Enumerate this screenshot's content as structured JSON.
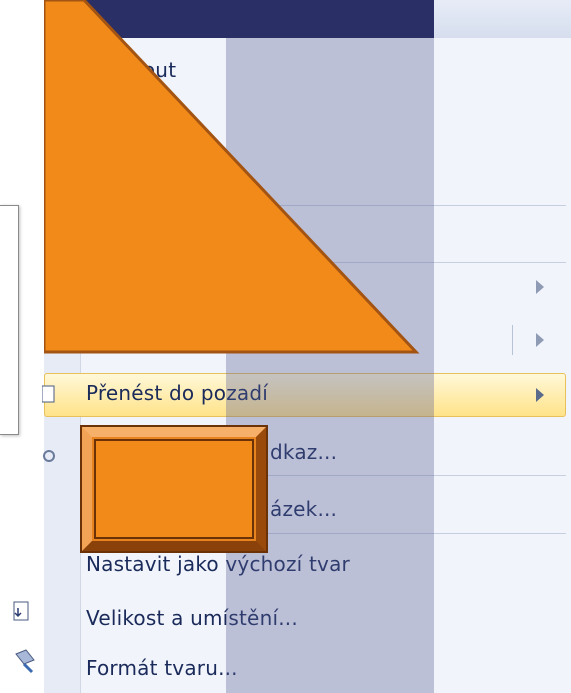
{
  "menu": {
    "items": [
      {
        "id": "bring-forward-partial",
        "label": "nout"
      },
      {
        "id": "partial-2",
        "label": "t"
      },
      {
        "id": "send-to-back",
        "label": "Přenést do pozadí"
      },
      {
        "id": "hyperlink",
        "label": "dkaz..."
      },
      {
        "id": "save-as-picture",
        "label": "ázek..."
      },
      {
        "id": "set-default-shape",
        "label": "Nastavit jako výchozí tvar"
      },
      {
        "id": "size-and-position",
        "label": "Velikost a umístění..."
      },
      {
        "id": "format-shape",
        "label": "Formát tvaru..."
      }
    ]
  },
  "colors": {
    "orange": "#f28a1a",
    "highlight": "#ffe38a",
    "menu_text": "#1a2a5a"
  },
  "icons": [
    "size-position-icon",
    "format-shape-icon",
    "submenu-arrow-icon"
  ]
}
